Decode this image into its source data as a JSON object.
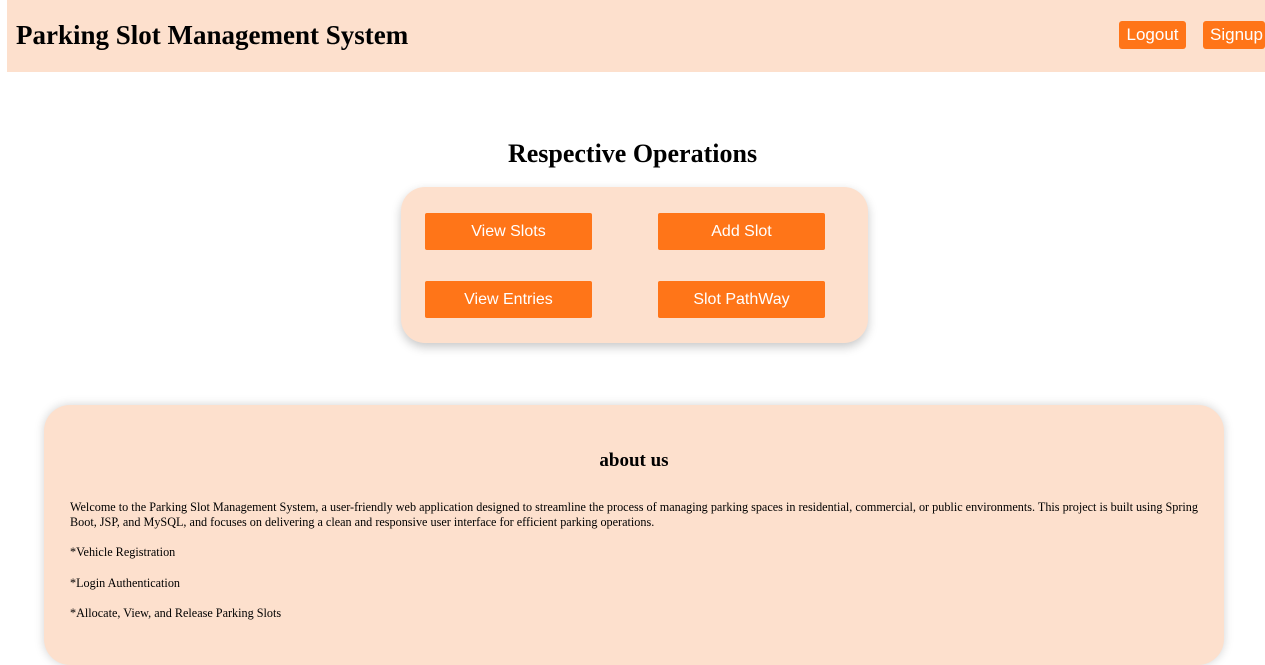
{
  "header": {
    "title": "Parking Slot Management System",
    "logout_label": "Logout",
    "signup_label": "Signup"
  },
  "operations": {
    "title": "Respective Operations",
    "buttons": [
      {
        "label": "View Slots"
      },
      {
        "label": "Add Slot"
      },
      {
        "label": "View Entries"
      },
      {
        "label": "Slot PathWay"
      }
    ]
  },
  "about": {
    "title": "about us",
    "description": "Welcome to the Parking Slot Management System, a user-friendly web application designed to streamline the process of managing parking spaces in residential, commercial, or public environments. This project is built using Spring Boot, JSP, and MySQL, and focuses on delivering a clean and responsive user interface for efficient parking operations.",
    "features": [
      "*Vehicle Registration",
      "*Login Authentication",
      "*Allocate, View, and Release Parking Slots"
    ]
  },
  "colors": {
    "header_bg": "#fde0cd",
    "button_bg": "#ff7518",
    "button_text": "#ffffff"
  }
}
